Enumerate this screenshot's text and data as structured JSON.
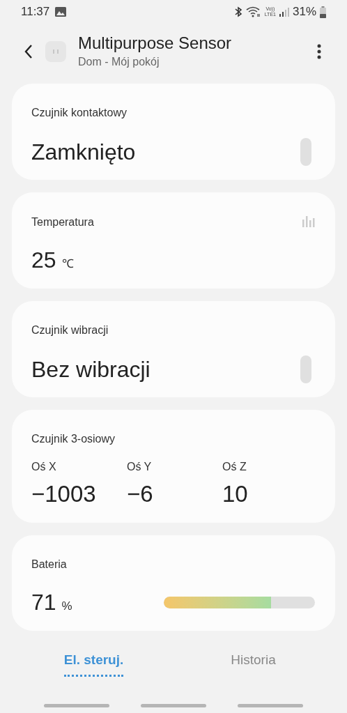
{
  "status_bar": {
    "time": "11:37",
    "volte": "Vo))",
    "lte": "LTE1",
    "battery_text": "31%"
  },
  "header": {
    "title": "Multipurpose Sensor",
    "subtitle": "Dom - Mój pokój"
  },
  "cards": [
    {
      "kind": "state",
      "label": "Czujnik kontaktowy",
      "value": "Zamknięto"
    },
    {
      "kind": "measure",
      "label": "Temperatura",
      "value": "25",
      "unit": "℃"
    },
    {
      "kind": "state",
      "label": "Czujnik wibracji",
      "value": "Bez wibracji"
    },
    {
      "kind": "axes",
      "label": "Czujnik 3-osiowy",
      "axes": [
        {
          "label": "Oś X",
          "value": "−1003"
        },
        {
          "label": "Oś Y",
          "value": "−6"
        },
        {
          "label": "Oś Z",
          "value": "10"
        }
      ]
    },
    {
      "kind": "battery",
      "label": "Bateria",
      "value": "71",
      "unit": "%",
      "level": 0.71
    }
  ],
  "tabs": [
    {
      "label": "El. steruj.",
      "selected": true
    },
    {
      "label": "Historia",
      "selected": false
    }
  ]
}
